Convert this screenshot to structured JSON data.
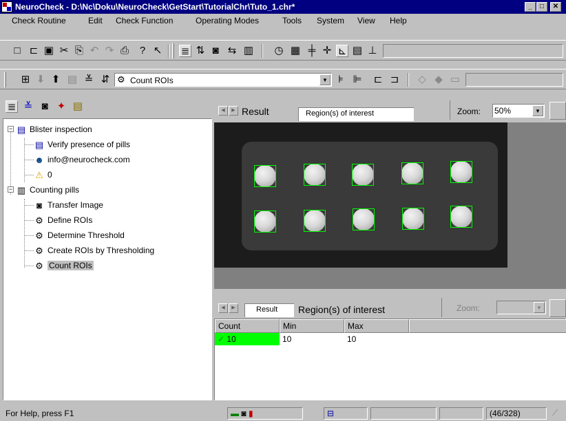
{
  "window": {
    "title": "NeuroCheck - D:\\Nc\\Doku\\NeuroCheck\\GetStart\\TutorialChr\\Tuto_1.chr*",
    "min_label": "_",
    "max_label": "□",
    "close_label": "✕"
  },
  "menu": {
    "items": [
      "Check Routine",
      "Edit",
      "Check Function",
      "Operating Modes",
      "Tools",
      "System",
      "View",
      "Help"
    ]
  },
  "toolbar2": {
    "function_combo_value": "Count ROIs"
  },
  "tree": {
    "nodes": [
      {
        "label": "Blister inspection"
      },
      {
        "label": "Verify presence of pills"
      },
      {
        "label": "info@neurocheck.com"
      },
      {
        "label": "0"
      },
      {
        "label": "Counting pills"
      },
      {
        "label": "Transfer Image"
      },
      {
        "label": "Define ROIs"
      },
      {
        "label": "Determine Threshold"
      },
      {
        "label": "Create ROIs by Thresholding"
      },
      {
        "label": "Count ROIs"
      }
    ]
  },
  "image_view": {
    "tabs": [
      "Result",
      "Region(s) of interest"
    ],
    "active_tab": "Region(s) of interest",
    "zoom_label": "Zoom:",
    "zoom_value": "50%"
  },
  "result_view": {
    "tabs": [
      "Result",
      "Region(s) of interest"
    ],
    "zoom_label": "Zoom:",
    "zoom_value": "",
    "columns": [
      "Count",
      "Min",
      "Max"
    ],
    "rows": [
      {
        "count": "10",
        "min": "10",
        "max": "10",
        "check_mark": "✓",
        "status_color": "#00ff00"
      }
    ]
  },
  "status": {
    "help_text": "For Help, press F1",
    "coords": "(46/328)"
  },
  "colors": {
    "titlebar": "#000080",
    "roi_outline": "#00ff00",
    "ok_cell": "#00ff00"
  }
}
